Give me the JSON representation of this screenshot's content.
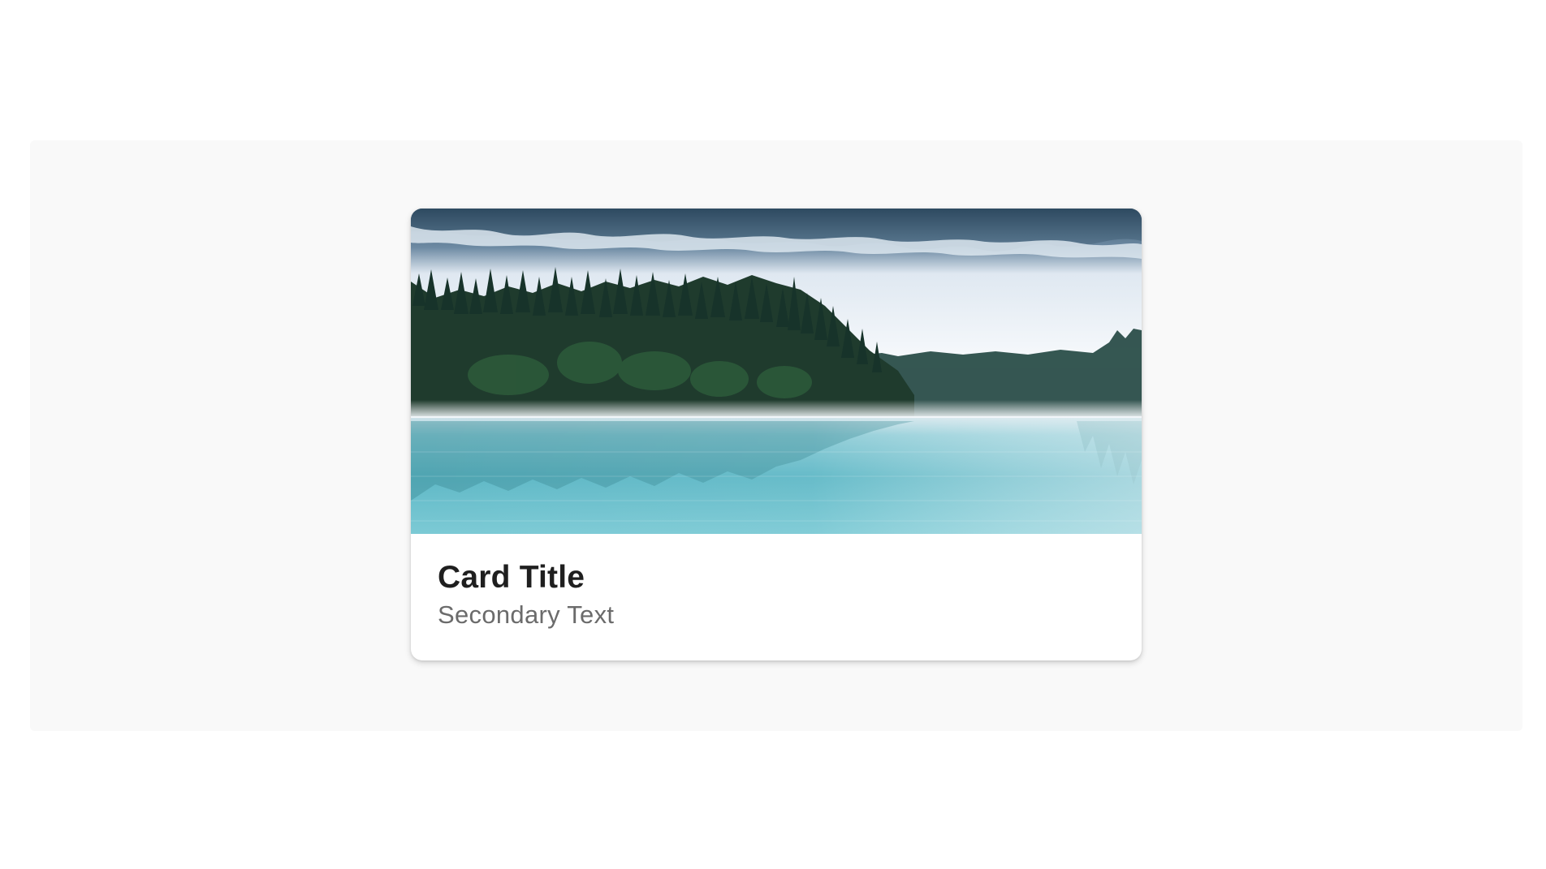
{
  "card": {
    "title": "Card Title",
    "secondary_text": "Secondary Text",
    "media": {
      "description_icon": "landscape-image",
      "colors": {
        "sky_top": "#3e5a72",
        "fog": "#f3f6fa",
        "forest": "#1f3d2e",
        "water": "#6cc0cd"
      }
    }
  }
}
